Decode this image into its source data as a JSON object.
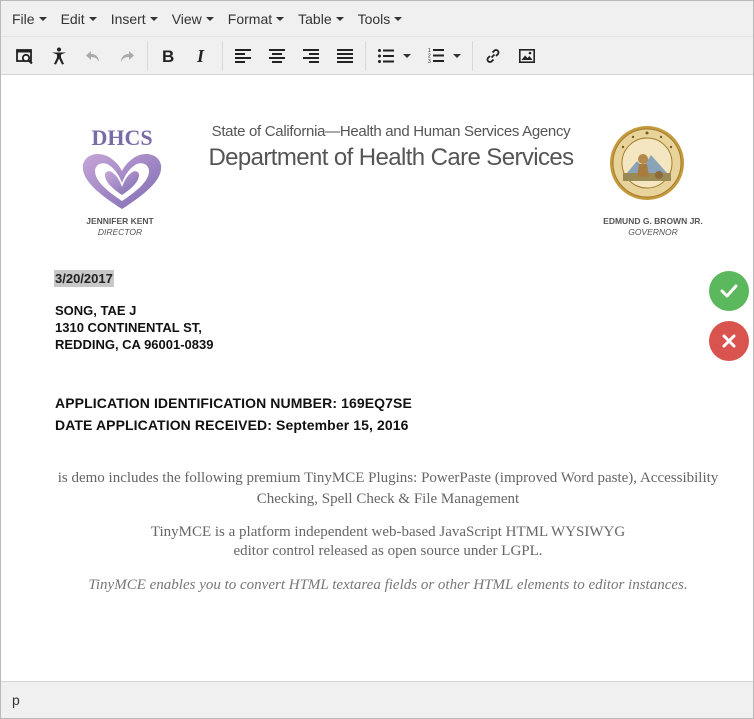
{
  "menubar": {
    "items": [
      {
        "label": "File"
      },
      {
        "label": "Edit"
      },
      {
        "label": "Insert"
      },
      {
        "label": "View"
      },
      {
        "label": "Format"
      },
      {
        "label": "Table"
      },
      {
        "label": "Tools"
      }
    ]
  },
  "toolbar": {
    "buttons": [
      "preview-icon",
      "accessibility-icon",
      "undo-icon",
      "redo-icon",
      "bold-icon",
      "italic-icon",
      "align-left-icon",
      "align-center-icon",
      "align-right-icon",
      "justify-icon",
      "bullet-list-icon",
      "numbered-list-icon",
      "link-icon",
      "image-icon"
    ]
  },
  "letterhead": {
    "logo_text": "DHCS",
    "agency": "State of California—Health and Human Services Agency",
    "department": "Department of Health Care Services",
    "director_name": "JENNIFER KENT",
    "director_title": "DIRECTOR",
    "governor_name": "EDMUND G. BROWN JR.",
    "governor_title": "GOVERNOR"
  },
  "letter": {
    "date": "3/20/2017",
    "address": [
      "SONG, TAE J",
      "1310 CONTINENTAL ST,",
      "REDDING, CA 96001-0839"
    ],
    "app_id_line": "APPLICATION IDENTIFICATION NUMBER: 169EQ7SE",
    "date_received_line": "DATE APPLICATION RECEIVED: September 15, 2016"
  },
  "paragraphs": {
    "p1_line1": "is demo includes the following premium TinyMCE Plugins: PowerPaste (improved Word paste), Accessibility",
    "p1_line2": "Checking, Spell Check & File Management",
    "p2_line1": "TinyMCE is a platform independent web-based JavaScript HTML WYSIWYG",
    "p2_line2": "editor control released as open source under LGPL.",
    "p3": "TinyMCE enables you to convert HTML textarea fields or other HTML elements to editor instances."
  },
  "statusbar": {
    "path": "p"
  },
  "colors": {
    "accept": "#5cb85c",
    "reject": "#d9534f",
    "logo_purple": "#7b6aa8"
  }
}
